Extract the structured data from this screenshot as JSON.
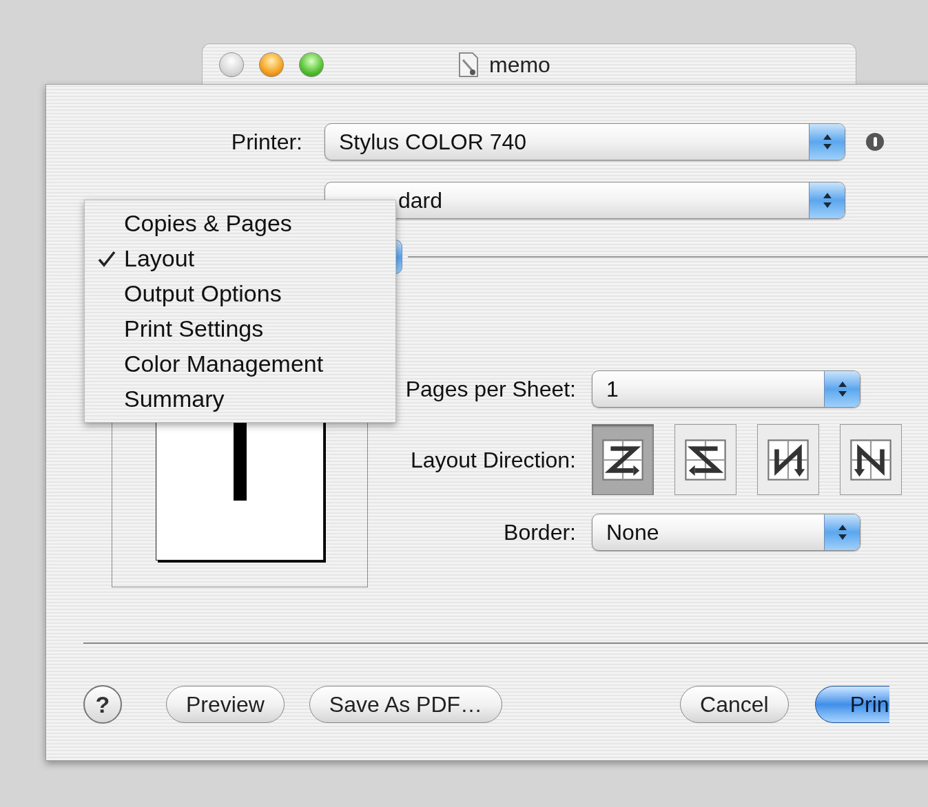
{
  "window": {
    "title": "memo",
    "traffic_lights": [
      {
        "kind": "close",
        "disabled": true
      },
      {
        "kind": "minimize",
        "disabled": false
      },
      {
        "kind": "zoom",
        "disabled": false
      }
    ]
  },
  "printer": {
    "label": "Printer:",
    "value": "Stylus COLOR 740"
  },
  "presets": {
    "value": "dard"
  },
  "section_menu": {
    "items": [
      {
        "label": "Copies & Pages",
        "checked": false
      },
      {
        "label": "Layout",
        "checked": true
      },
      {
        "label": "Output Options",
        "checked": false
      },
      {
        "label": "Print Settings",
        "checked": false
      },
      {
        "label": "Color Management",
        "checked": false
      },
      {
        "label": "Summary",
        "checked": false
      }
    ]
  },
  "pages_per_sheet": {
    "label": "Pages per Sheet:",
    "value": "1"
  },
  "layout_direction": {
    "label": "Layout Direction:",
    "options": [
      {
        "kind": "z",
        "selected": true
      },
      {
        "kind": "s",
        "selected": false
      },
      {
        "kind": "n_mirrored",
        "selected": false
      },
      {
        "kind": "n",
        "selected": false
      }
    ]
  },
  "border": {
    "label": "Border:",
    "value": "None"
  },
  "help_button": "?",
  "buttons": [
    {
      "label": "Preview",
      "kind": "normal"
    },
    {
      "label": "Save As PDF…",
      "kind": "normal"
    },
    {
      "label": "Cancel",
      "kind": "normal"
    },
    {
      "label": "Prin",
      "kind": "default"
    }
  ]
}
